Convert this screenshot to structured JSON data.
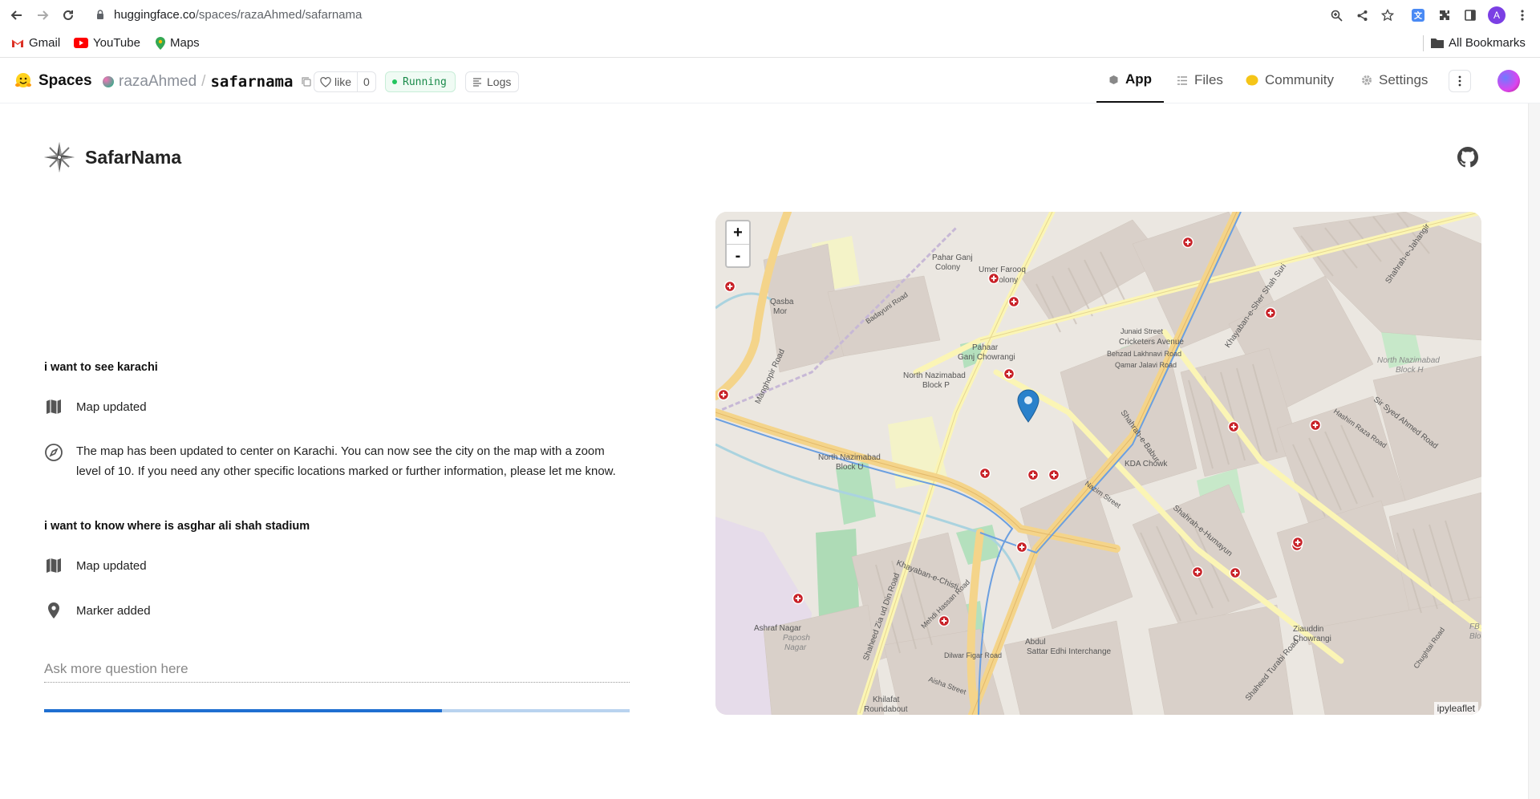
{
  "browser": {
    "url_host": "huggingface.co",
    "url_path": "/spaces/razaAhmed/safarnama",
    "bookmarks": [
      "Gmail",
      "YouTube",
      "Maps"
    ],
    "all_bookmarks": "All Bookmarks",
    "profile_initial": "A"
  },
  "hf": {
    "spaces_label": "Spaces",
    "owner": "razaAhmed",
    "separator": "/",
    "repo": "safarnama",
    "like_label": "like",
    "like_count": "0",
    "status": "Running",
    "logs_label": "Logs",
    "tabs": [
      {
        "label": "App",
        "icon": "cube-icon",
        "active": true
      },
      {
        "label": "Files",
        "icon": "files-icon",
        "active": false
      },
      {
        "label": "Community",
        "icon": "community-icon",
        "active": false
      },
      {
        "label": "Settings",
        "icon": "gear-icon",
        "active": false
      }
    ]
  },
  "app": {
    "title": "SafarNama",
    "messages": [
      {
        "type": "user",
        "text": "i want to see karachi"
      },
      {
        "type": "tool",
        "icon": "map-icon",
        "text": "Map updated"
      },
      {
        "type": "assistant",
        "icon": "compass-icon",
        "text": "The map has been updated to center on Karachi. You can now see the city on the map with a zoom level of 10. If you need any other specific locations marked or further information, please let me know."
      },
      {
        "type": "user",
        "text": "i want to know where is asghar ali shah stadium"
      },
      {
        "type": "tool",
        "icon": "map-icon",
        "text": "Map updated"
      },
      {
        "type": "tool",
        "icon": "pin-icon",
        "text": "Marker added"
      }
    ],
    "input_placeholder": "Ask more question here",
    "progress_fraction": 0.68
  },
  "map": {
    "zoom_in": "+",
    "zoom_out": "-",
    "attribution": "ipyleaflet",
    "labels": [
      "Pahar Ganj Colony",
      "Umer Farooq Colony",
      "Qasba Mor",
      "Badayuni Road",
      "Manghopir Road",
      "Pahaar Ganj Chowrangi",
      "North Nazimabad Block P",
      "North Nazimabad Block U",
      "Cricketers Avenue",
      "Junaid Street",
      "Behzad Lakhnavi Road",
      "Qamar Jalavi Road",
      "North Nazimabad Block H",
      "Sir Syed Ahmed Road",
      "KDA Chowk",
      "Shahrah-e-Humayun",
      "Khayaban-e-Chisti",
      "Ashraf Nagar",
      "Paposh Nagar",
      "Dilwar Figar Road",
      "Abdul Sattar Edhi Interchange",
      "Khilafat Roundabout",
      "Ziauddin Chowrangi",
      "Khayaban-e-Sher Shah Suri",
      "Shahrah-e-Jahangir",
      "Mehdi Hassan Road",
      "Nazim Street",
      "Aisha Street",
      "Shaheed Turabi Road",
      "Hashim Raza Road",
      "Chughtai Road",
      "FB Area Block",
      "Shahrah-e-Babur"
    ],
    "colors": {
      "land": "#ebe7e1",
      "major_road": "#f4d48a",
      "secondary_road": "#fbf5b5",
      "park": "#b4e0bd",
      "marker": "#2a81cb",
      "poi": "#c82127"
    }
  }
}
